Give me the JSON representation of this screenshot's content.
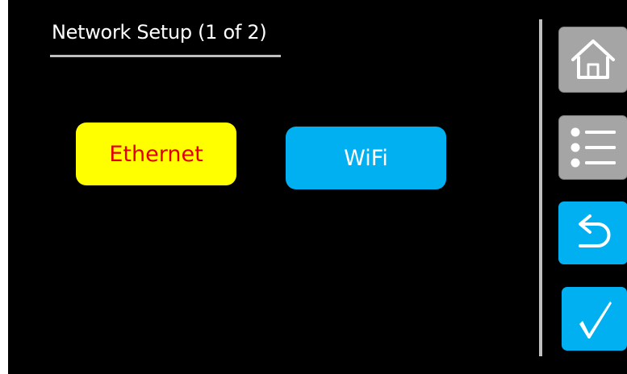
{
  "header": {
    "title": "Network Setup (1 of 2)"
  },
  "options": {
    "ethernet_label": "Ethernet",
    "wifi_label": "WiFi"
  },
  "sidebar": {
    "home_icon": "home-icon",
    "menu_icon": "list-menu-icon",
    "back_icon": "undo-arrow-icon",
    "confirm_icon": "checkmark-icon"
  },
  "colors": {
    "screen_background": "#000000",
    "ethernet_button": "#ffff00",
    "ethernet_text": "#e00000",
    "wifi_button": "#00b0f0",
    "wifi_text": "#ffffff",
    "nav_button_gray": "#a5a5a5",
    "nav_button_blue": "#00b0f0",
    "divider": "#c0c0c0"
  }
}
